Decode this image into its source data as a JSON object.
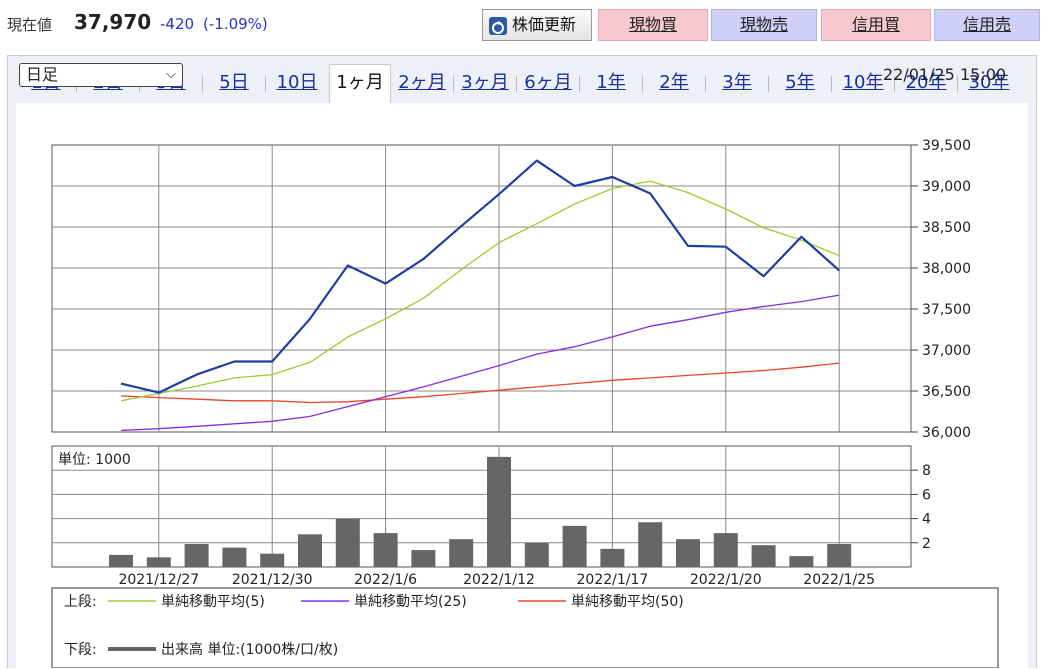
{
  "header": {
    "price_label": "現在値",
    "price_value": "37,970",
    "change": "-420",
    "change_pct": "(-1.09%)",
    "refresh_label": "株価更新",
    "buttons": [
      "現物買",
      "現物売",
      "信用買",
      "信用売"
    ]
  },
  "tabs": [
    "1日",
    "2日",
    "3日",
    "5日",
    "10日",
    "1ヶ月",
    "2ヶ月",
    "3ヶ月",
    "6ヶ月",
    "1年",
    "2年",
    "3年",
    "5年",
    "10年",
    "20年",
    "30年"
  ],
  "active_tab": "1ヶ月",
  "chart_controls": {
    "interval": "日足",
    "timestamp": "22/01/25 15:00"
  },
  "legend": {
    "upper_label": "上段:",
    "lower_label": "下段:",
    "items": [
      "単純移動平均(5)",
      "単純移動平均(25)",
      "単純移動平均(50)"
    ],
    "volume_item": "出来高 単位:(1000株/口/枚)"
  },
  "volume_unit_label": "単位: 1000",
  "colors": {
    "price": "#1e3f9f",
    "ma5": "#9acd32",
    "ma25": "#8a2be2",
    "ma50": "#e8462a",
    "volume": "#666666",
    "grid": "#888888"
  },
  "chart_data": [
    {
      "type": "line",
      "x_tick_labels": [
        "2021/12/27",
        "2021/12/30",
        "2022/1/6",
        "2022/1/12",
        "2022/1/17",
        "2022/1/20",
        "2022/1/25"
      ],
      "x": [
        "2021/12/24",
        "2021/12/27",
        "2021/12/28",
        "2021/12/29",
        "2021/12/30",
        "2022/1/4",
        "2022/1/5",
        "2022/1/6",
        "2022/1/7",
        "2022/1/11",
        "2022/1/12",
        "2022/1/13",
        "2022/1/14",
        "2022/1/17",
        "2022/1/18",
        "2022/1/19",
        "2022/1/20",
        "2022/1/21",
        "2022/1/24",
        "2022/1/25"
      ],
      "ylim": [
        36000,
        39500
      ],
      "y_ticks": [
        "39,500",
        "39,000",
        "38,500",
        "38,000",
        "37,500",
        "37,000",
        "36,500",
        "36,000"
      ],
      "y_tick_values": [
        39500,
        39000,
        38500,
        38000,
        37500,
        37000,
        36500,
        36000
      ],
      "grid": true,
      "series": [
        {
          "name": "",
          "values": [
            36590,
            36480,
            36700,
            36860,
            36860,
            37380,
            38030,
            37810,
            38110,
            38510,
            38900,
            39310,
            39000,
            39110,
            38910,
            38270,
            38260,
            37900,
            38380,
            37970
          ]
        },
        {
          "name": "単純移動平均(5)",
          "values": [
            36380,
            36470,
            36560,
            36660,
            36700,
            36850,
            37160,
            37380,
            37630,
            37980,
            38310,
            38540,
            38780,
            38970,
            39060,
            38920,
            38720,
            38490,
            38340,
            38150
          ]
        },
        {
          "name": "単純移動平均(25)",
          "values": [
            36020,
            36040,
            36070,
            36100,
            36130,
            36190,
            36310,
            36430,
            36550,
            36680,
            36810,
            36950,
            37040,
            37160,
            37290,
            37370,
            37460,
            37530,
            37590,
            37670
          ]
        },
        {
          "name": "単純移動平均(50)",
          "values": [
            36440,
            36420,
            36400,
            36380,
            36380,
            36360,
            36370,
            36400,
            36430,
            36470,
            36510,
            36550,
            36590,
            36630,
            36660,
            36690,
            36720,
            36750,
            36790,
            36840
          ]
        }
      ]
    },
    {
      "type": "bar",
      "x": [
        "2021/12/24",
        "2021/12/27",
        "2021/12/28",
        "2021/12/29",
        "2021/12/30",
        "2022/1/4",
        "2022/1/5",
        "2022/1/6",
        "2022/1/7",
        "2022/1/11",
        "2022/1/12",
        "2022/1/13",
        "2022/1/14",
        "2022/1/17",
        "2022/1/18",
        "2022/1/19",
        "2022/1/20",
        "2022/1/21",
        "2022/1/24",
        "2022/1/25"
      ],
      "ylim": [
        0,
        10
      ],
      "y_ticks": [
        "8",
        "6",
        "4",
        "2"
      ],
      "y_tick_values": [
        8,
        6,
        4,
        2
      ],
      "series": [
        {
          "name": "出来高",
          "values": [
            1.0,
            0.8,
            1.9,
            1.6,
            1.1,
            2.7,
            4.0,
            2.8,
            1.4,
            2.3,
            9.1,
            2.0,
            3.4,
            1.5,
            3.7,
            2.3,
            2.8,
            1.8,
            0.9,
            1.9
          ]
        }
      ]
    }
  ]
}
